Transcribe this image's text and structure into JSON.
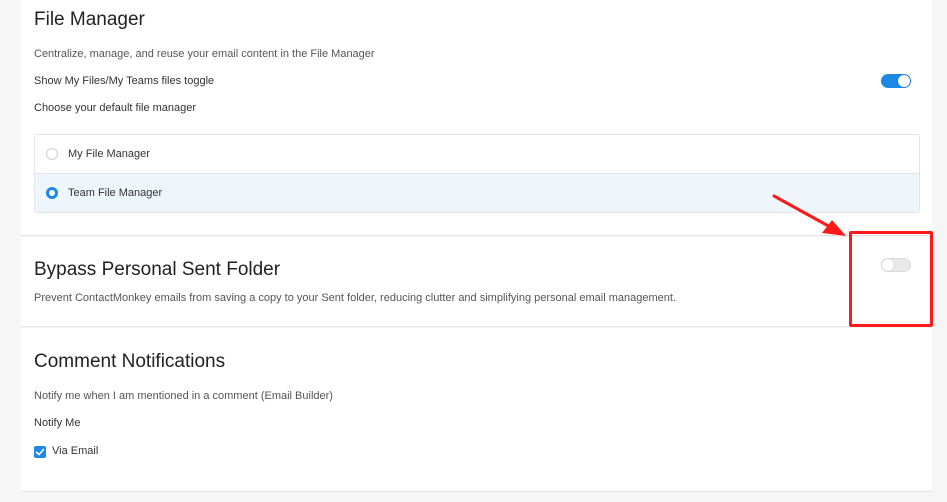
{
  "file_manager": {
    "title": "File Manager",
    "description": "Centralize, manage, and reuse your email content in the File Manager",
    "toggle_label": "Show My Files/My Teams files toggle",
    "toggle_state": "on",
    "choose_label": "Choose your default file manager",
    "options": [
      {
        "label": "My File Manager",
        "selected": false
      },
      {
        "label": "Team File Manager",
        "selected": true
      }
    ]
  },
  "bypass": {
    "title": "Bypass Personal Sent Folder",
    "description": "Prevent ContactMonkey emails from saving a copy to your Sent folder, reducing clutter and simplifying personal email management.",
    "toggle_state": "off"
  },
  "comments": {
    "title": "Comment Notifications",
    "description": "Notify me when I am mentioned in a comment (Email Builder)",
    "notify_label": "Notify Me",
    "via_email_label": "Via Email",
    "via_email_checked": true
  },
  "colors": {
    "accent": "#1e88e5",
    "annotation": "#ff1a1a",
    "selected_row_bg": "#eef6fb"
  }
}
